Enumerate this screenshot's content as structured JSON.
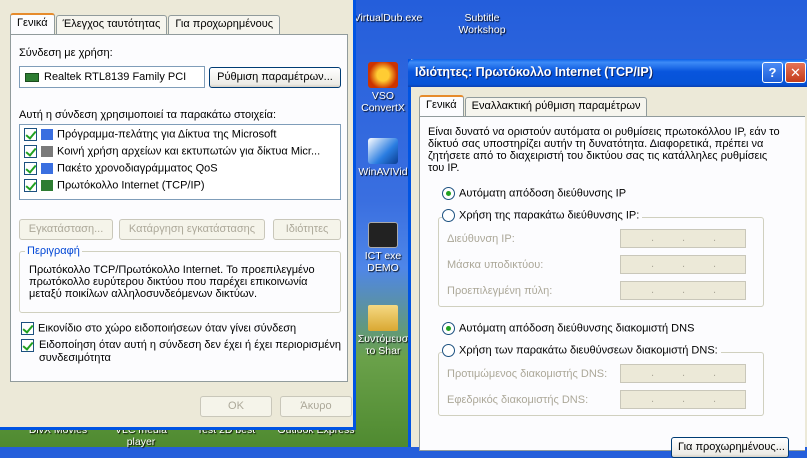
{
  "desktop": {
    "icons": [
      {
        "label": "VirtualDub.exe"
      },
      {
        "label": "Subtitle Workshop"
      },
      {
        "label": "VSO ConvertX"
      },
      {
        "label": "WinAVIVid"
      },
      {
        "label": "ICT exe DEMO"
      },
      {
        "label": "Συντόμευσ το Shar"
      },
      {
        "label": "DivX Movies"
      },
      {
        "label": "VLC media player"
      },
      {
        "label": "Test 2D best"
      },
      {
        "label": "Outlook Express"
      }
    ]
  },
  "left_dialog": {
    "tabs": [
      {
        "label": "Γενικά"
      },
      {
        "label": "Έλεγχος ταυτότητας"
      },
      {
        "label": "Για προχωρημένους"
      }
    ],
    "connect_using_label": "Σύνδεση με χρήση:",
    "adapter_name": "Realtek RTL8139 Family PCI",
    "configure_label": "Ρύθμιση παραμέτρων...",
    "items_label": "Αυτή η σύνδεση χρησιμοποιεί τα παρακάτω στοιχεία:",
    "items": [
      {
        "label": "Πρόγραμμα-πελάτης για Δίκτυα της Microsoft"
      },
      {
        "label": "Κοινή χρήση αρχείων και εκτυπωτών για δίκτυα Micr..."
      },
      {
        "label": "Πακέτο χρονοδιαγράμματος QoS"
      },
      {
        "label": "Πρωτόκολλο Internet (TCP/IP)"
      }
    ],
    "install_label": "Εγκατάσταση...",
    "uninstall_label": "Κατάργηση εγκατάστασης",
    "properties_label": "Ιδιότητες",
    "description_title": "Περιγραφή",
    "description_text": "Πρωτόκολλο TCP/Πρωτόκολλο Internet. Το προεπιλεγμένο πρωτόκολλο ευρύτερου δικτύου που παρέχει επικοινωνία μεταξύ ποικίλων αλληλοσυνδεόμενων δικτύων.",
    "show_icon_label": "Εικονίδιο στο χώρο ειδοποιήσεων όταν γίνει σύνδεση",
    "notify_label": "Ειδοποίηση όταν αυτή η σύνδεση δεν έχει ή έχει περιορισμένη συνδεσιμότητα",
    "ok_label": "OK",
    "cancel_label": "Άκυρο"
  },
  "right_dialog": {
    "title": "Ιδιότητες: Πρωτόκολλο Internet (TCP/IP)",
    "help_label": "?",
    "close_label": "✕",
    "tabs": [
      {
        "label": "Γενικά"
      },
      {
        "label": "Εναλλακτική ρύθμιση παραμέτρων"
      }
    ],
    "intro_text": "Είναι δυνατό να οριστούν αυτόματα οι ρυθμίσεις πρωτοκόλλου IP, εάν το δίκτυό σας υποστηρίζει αυτήν τη δυνατότητα. Διαφορετικά, πρέπει να ζητήσετε από το διαχειριστή του δικτύου σας τις κατάλληλες ρυθμίσεις του IP.",
    "auto_ip_label": "Αυτόματη απόδοση διεύθυνσης IP",
    "manual_ip_label": "Χρήση της παρακάτω διεύθυνσης IP:",
    "ip_address_label": "Διεύθυνση IP:",
    "subnet_label": "Μάσκα υποδικτύου:",
    "gateway_label": "Προεπιλεγμένη πύλη:",
    "auto_dns_label": "Αυτόματη απόδοση διεύθυνσης διακομιστή DNS",
    "manual_dns_label": "Χρήση των παρακάτω διευθύνσεων διακομιστή DNS:",
    "preferred_dns_label": "Προτιμώμενος διακομιστής DNS:",
    "alternate_dns_label": "Εφεδρικός διακομιστής DNS:",
    "advanced_label": "Για προχωρημένους...",
    "ip_dot": "."
  }
}
